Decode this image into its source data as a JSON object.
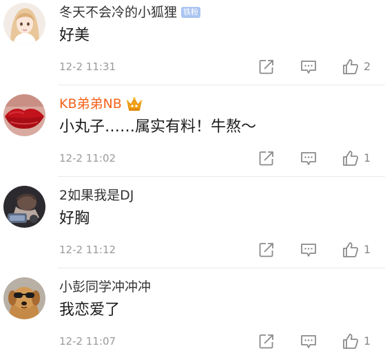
{
  "comments": [
    {
      "username": "冬天不会冷的小狐狸",
      "badge": "铁粉",
      "content": "好美",
      "time": "12-2 11:31",
      "likes": "2"
    },
    {
      "username": "KB弟弟NB",
      "badge_icon": "crown-icon",
      "content": "小丸子……属实有料！牛熬～",
      "time": "12-2 11:02",
      "likes": "1"
    },
    {
      "username": "2如果我是DJ",
      "content": "好胸",
      "time": "12-2 11:12",
      "likes": "1"
    },
    {
      "username": "小彭同学冲冲冲",
      "content": "我恋爱了",
      "time": "12-2 11:07",
      "likes": "1"
    }
  ],
  "colors": {
    "vip_name": "#f5631b",
    "fan_badge": "#a9c4f0",
    "icon_gray": "#8a8a8a"
  },
  "icons": [
    "share-icon",
    "reply-icon",
    "like-icon"
  ]
}
